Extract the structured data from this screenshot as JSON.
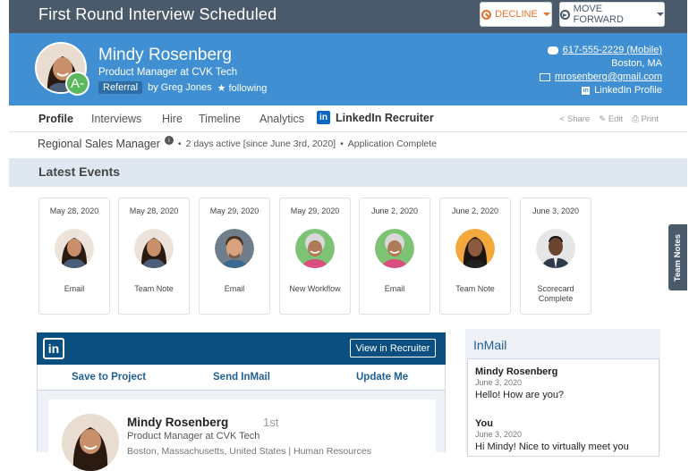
{
  "header": {
    "title": "First Round Interview Scheduled",
    "decline_label": "DECLINE",
    "forward_label": "MOVE FORWARD"
  },
  "candidate": {
    "name": "Mindy Rosenberg",
    "title": "Product Manager at CVK Tech",
    "source_tag": "Referral",
    "referred_by": "by Greg Jones",
    "following": "following",
    "grade": "A-",
    "phone": "617-555-2229 (Mobile)",
    "location": "Boston, MA",
    "email": "mrosenberg@gmail.com",
    "linkedin_profile": "LinkedIn Profile"
  },
  "tabs": {
    "items": [
      "Profile",
      "Interviews",
      "Hire",
      "Timeline",
      "Analytics"
    ],
    "linkedin": "LinkedIn Recruiter",
    "share": "Share",
    "edit": "Edit",
    "print": "Print"
  },
  "job": {
    "role": "Regional Sales Manager",
    "activity": "2 days active [since June 3rd, 2020]",
    "status": "Application Complete"
  },
  "events": {
    "heading": "Latest Events",
    "items": [
      {
        "date": "May 28, 2020",
        "label": "Email"
      },
      {
        "date": "May 28, 2020",
        "label": "Team Note"
      },
      {
        "date": "May 29, 2020",
        "label": "Email"
      },
      {
        "date": "May 29, 2020",
        "label": "New Workflow"
      },
      {
        "date": "June 2, 2020",
        "label": "Email"
      },
      {
        "date": "June 2, 2020",
        "label": "Team Note"
      },
      {
        "date": "June 3, 2020",
        "label": "Scorecard Complete"
      }
    ]
  },
  "side_tab": "Team Notes",
  "linkedin_panel": {
    "logo": "in",
    "view_button": "View in Recruiter",
    "actions": [
      "Save to Project",
      "Send InMail",
      "Update Me"
    ],
    "name": "Mindy Rosenberg",
    "degree": "1st",
    "headline": "Product Manager at CVK Tech",
    "location": "Boston, Massachusetts, United States | Human Resources"
  },
  "inmail": {
    "title": "InMail",
    "messages": [
      {
        "from": "Mindy Rosenberg",
        "date": "June 3, 2020",
        "text": "Hello! How are you?"
      },
      {
        "from": "You",
        "date": "June 3, 2020",
        "text": "Hi Mindy! Nice to virtually meet you"
      }
    ]
  },
  "colors": {
    "topbar": "#4a5a6a",
    "banner": "#3f8fd2",
    "decline": "#e8702a",
    "grade": "#5cb85c",
    "linkedin": "#0a4f7f"
  }
}
